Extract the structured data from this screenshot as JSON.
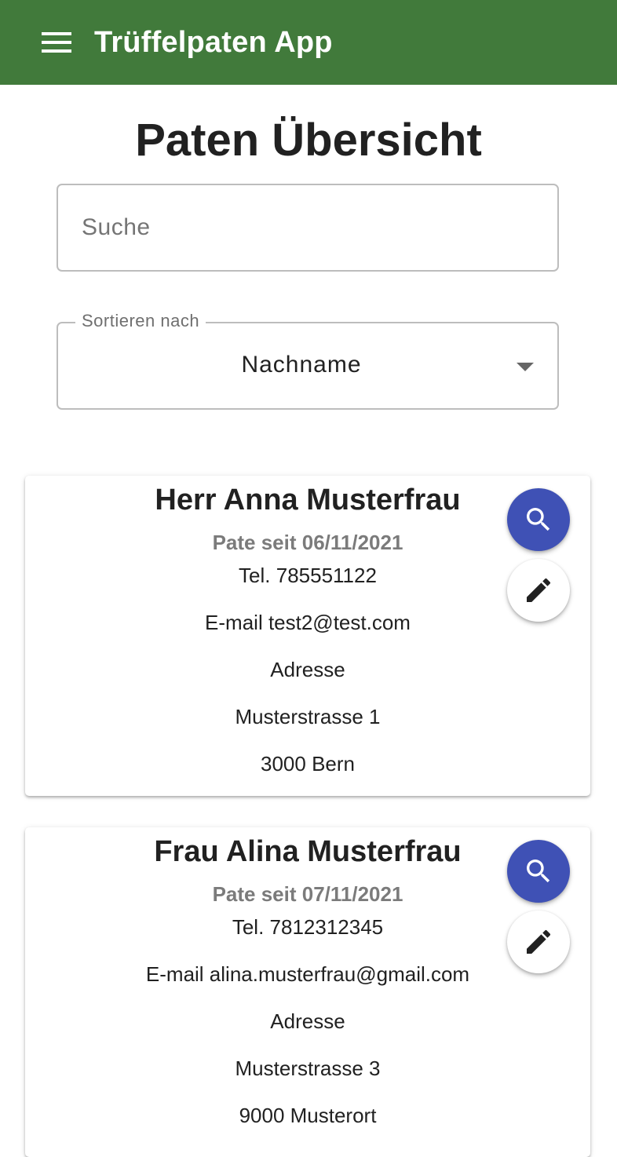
{
  "app": {
    "title": "Trüffelpaten App",
    "menu_icon": "menu-icon",
    "bar_color": "#417a3b"
  },
  "page": {
    "title": "Paten Übersicht"
  },
  "search": {
    "placeholder": "Suche",
    "value": ""
  },
  "sort": {
    "label": "Sortieren nach",
    "selected": "Nachname",
    "icon": "dropdown-arrow-icon"
  },
  "actions": {
    "search_icon": "search-icon",
    "search_color": "#3f51b5",
    "edit_icon": "edit-icon"
  },
  "sponsors": [
    {
      "name": "Herr Anna Musterfrau",
      "since": "Pate seit 06/11/2021",
      "tel": "Tel. 785551122",
      "email": "E-mail test2@test.com",
      "address_label": "Adresse",
      "street": "Musterstrasse 1",
      "city": "3000 Bern"
    },
    {
      "name": "Frau Alina Musterfrau",
      "since": "Pate seit 07/11/2021",
      "tel": "Tel. 7812312345",
      "email": "E-mail alina.musterfrau@gmail.com",
      "address_label": "Adresse",
      "street": "Musterstrasse 3",
      "city": "9000 Musterort"
    }
  ]
}
